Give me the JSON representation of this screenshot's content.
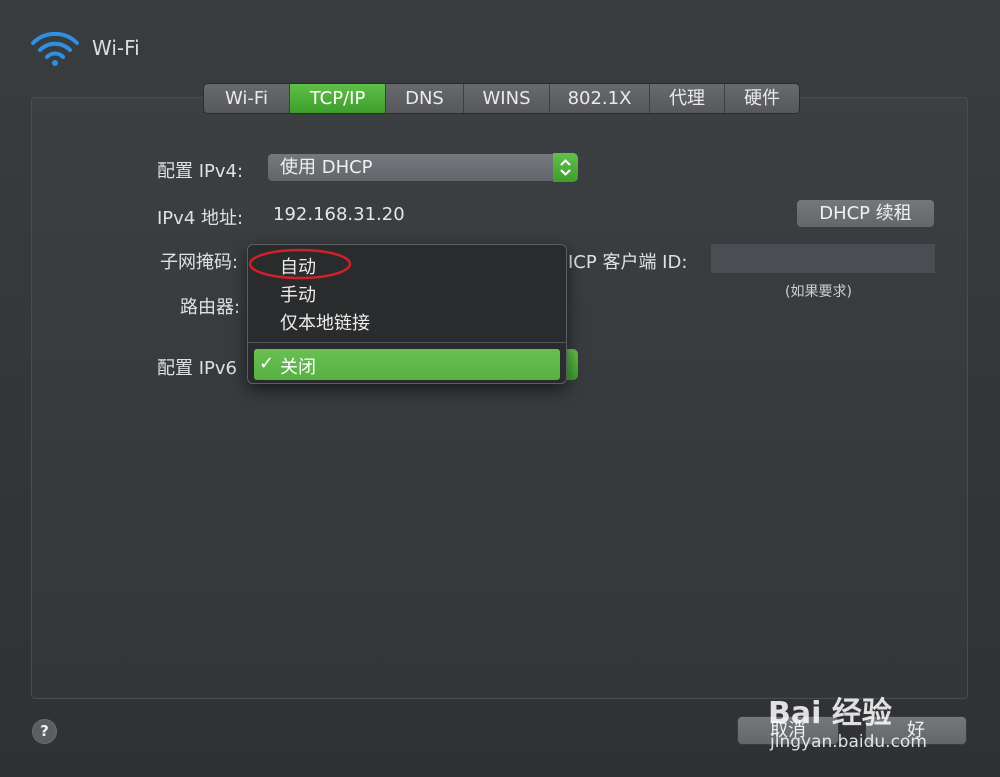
{
  "window": {
    "title": "Wi-Fi"
  },
  "tabs": [
    "Wi-Fi",
    "TCP/IP",
    "DNS",
    "WINS",
    "802.1X",
    "代理",
    "硬件"
  ],
  "active_tab": "TCP/IP",
  "form": {
    "configure_ipv4_label": "配置 IPv4:",
    "configure_ipv4_value": "使用 DHCP",
    "ipv4_address_label": "IPv4 地址:",
    "ipv4_address_value": "192.168.31.20",
    "renew_dhcp_button": "DHCP 续租",
    "subnet_mask_label": "子网掩码:",
    "dhcp_client_id_label": "ICP 客户端 ID:",
    "dhcp_client_id_value": "",
    "dhcp_client_id_hint": "(如果要求)",
    "router_label": "路由器:",
    "configure_ipv6_label": "配置 IPv6"
  },
  "ipv6_menu": {
    "items": [
      "自动",
      "手动",
      "仅本地链接"
    ],
    "selected_item": "关闭",
    "checkmark": "✓"
  },
  "footer": {
    "help": "?",
    "cancel_button": "取消",
    "ok_button": "好"
  },
  "watermark": {
    "logo_text": "Bai 经验",
    "url": "jingyan.baidu.com"
  },
  "colors": {
    "accent_green": "#4caf3a",
    "annotation_red": "#d0202a",
    "background": "#37393c"
  },
  "icons": {
    "wifi": "wifi-icon",
    "help": "help-icon",
    "stepper": "stepper-arrows-icon"
  }
}
